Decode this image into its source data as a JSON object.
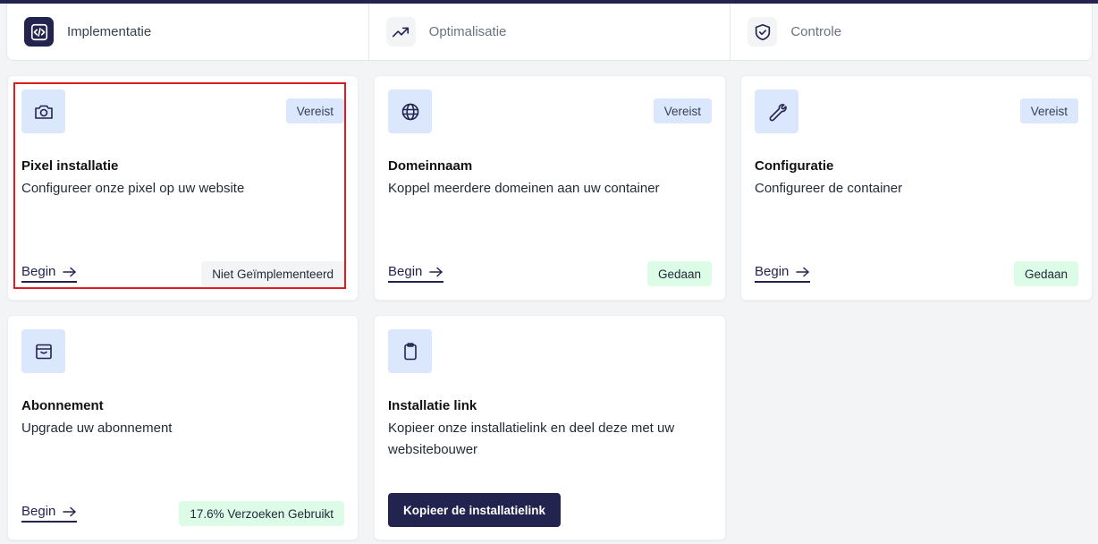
{
  "tabs": [
    {
      "label": "Implementatie",
      "icon": "code-icon",
      "active": true
    },
    {
      "label": "Optimalisatie",
      "icon": "trending-up-icon",
      "active": false
    },
    {
      "label": "Controle",
      "icon": "shield-check-icon",
      "active": false
    }
  ],
  "cards": {
    "pixel": {
      "icon": "camera-icon",
      "badge": "Vereist",
      "title": "Pixel installatie",
      "description": "Configureer onze pixel op uw website",
      "link": "Begin",
      "status": "Niet Geïmplementeerd"
    },
    "domain": {
      "icon": "globe-icon",
      "badge": "Vereist",
      "title": "Domeinnaam",
      "description": "Koppel meerdere domeinen aan uw container",
      "link": "Begin",
      "status": "Gedaan"
    },
    "config": {
      "icon": "wrench-icon",
      "badge": "Vereist",
      "title": "Configuratie",
      "description": "Configureer de container",
      "link": "Begin",
      "status": "Gedaan"
    },
    "subscription": {
      "icon": "archive-icon",
      "title": "Abonnement",
      "description": "Upgrade uw abonnement",
      "link": "Begin",
      "status": "17.6% Verzoeken Gebruikt"
    },
    "install_link": {
      "icon": "clipboard-icon",
      "title": "Installatie link",
      "description": "Kopieer onze installatielink en deel deze met uw websitebouwer",
      "button": "Kopieer de installatielink"
    }
  },
  "colors": {
    "primary": "#232350",
    "badge_blue": "#dbe7fc",
    "success": "#dcfce7",
    "highlight": "#e01b1b"
  }
}
